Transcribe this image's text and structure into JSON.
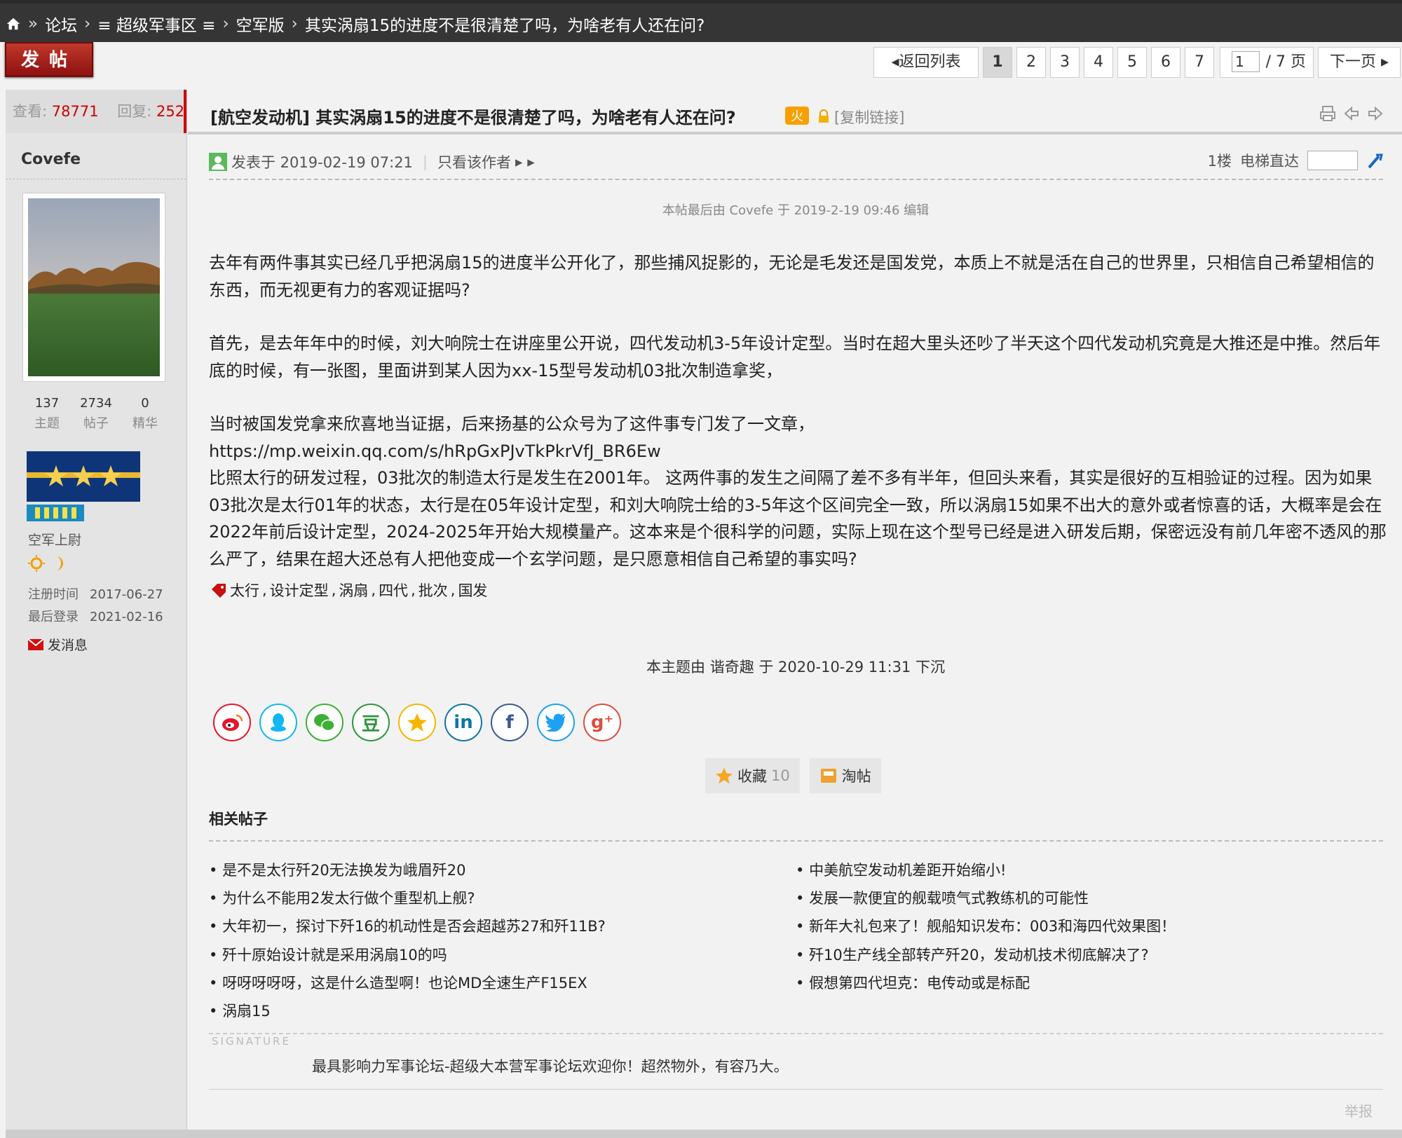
{
  "breadcrumb": {
    "sep1": "»",
    "forum": "论坛",
    "sep2": "›",
    "section": "≡ 超级军事区 ≡",
    "sep3": "›",
    "board": "空军版",
    "sep4": "›",
    "thread": "其实涡扇15的进度不是很清楚了吗，为啥老有人还在问?"
  },
  "toolbar": {
    "post_label": "发帖",
    "back_label": "返回列表",
    "pages": [
      "1",
      "2",
      "3",
      "4",
      "5",
      "6",
      "7"
    ],
    "current_page": "1",
    "page_input": "1",
    "page_total": "/ 7 页",
    "next_label": "下一页"
  },
  "thread": {
    "views_label": "查看:",
    "views": "78771",
    "replies_label": "回复:",
    "replies": "252",
    "title": "[航空发动机] 其实涡扇15的进度不是很清楚了吗，为啥老有人还在问?",
    "copy_link": "[复制链接]"
  },
  "author": {
    "name": "Covefe",
    "stats": [
      {
        "value": "137",
        "label": "主题"
      },
      {
        "value": "2734",
        "label": "帖子"
      },
      {
        "value": "0",
        "label": "精华"
      }
    ],
    "rank": "空军上尉",
    "reg_label": "注册时间",
    "reg_date": "2017-06-27",
    "login_label": "最后登录",
    "login_date": "2021-02-16",
    "send_msg": "发消息"
  },
  "post": {
    "posted_at": "发表于 2019-02-19 07:21",
    "only_author": "只看该作者",
    "floor": "1楼",
    "elevator": "电梯直达",
    "edit_note": "本帖最后由 Covefe 于 2019-2-19 09:46 编辑",
    "paragraphs": [
      "去年有两件事其实已经几乎把涡扇15的进度半公开化了，那些捕风捉影的，无论是毛发还是国发党，本质上不就是活在自己的世界里，只相信自己希望相信的东西，而无视更有力的客观证据吗?",
      "首先，是去年年中的时候，刘大响院士在讲座里公开说，四代发动机3-5年设计定型。当时在超大里头还吵了半天这个四代发动机究竟是大推还是中推。然后年底的时候，有一张图，里面讲到某人因为xx-15型号发动机03批次制造拿奖，",
      "当时被国发党拿来欣喜地当证据，后来扬基的公众号为了这件事专门发了一文章，\nhttps://mp.weixin.qq.com/s/hRpGxPJvTkPkrVfJ_BR6Ew\n比照太行的研发过程，03批次的制造太行是发生在2001年。 这两件事的发生之间隔了差不多有半年，但回头来看，其实是很好的互相验证的过程。因为如果03批次是太行01年的状态，太行是在05年设计定型，和刘大响院士给的3-5年这个区间完全一致，所以涡扇15如果不出大的意外或者惊喜的话，大概率是会在2022年前后设计定型，2024-2025年开始大规模量产。这本来是个很科学的问题，实际上现在这个型号已经是进入研发后期，保密远没有前几年密不透风的那么严了，结果在超大还总有人把他变成一个玄学问题，是只愿意相信自己希望的事实吗?"
    ],
    "tags": [
      "太行",
      "设计定型",
      "涡扇",
      "四代",
      "批次",
      "国发"
    ],
    "sink_note": "本主题由 谐奇趣 于 2020-10-29 11:31 下沉",
    "favorite_label": "收藏",
    "favorite_count": "10",
    "tao_label": "淘帖"
  },
  "share": [
    {
      "icon": "weibo-icon",
      "color": "#e6162d"
    },
    {
      "icon": "qq-icon",
      "color": "#12b7f5"
    },
    {
      "icon": "wechat-icon",
      "color": "#3cb034"
    },
    {
      "icon": "douban-icon",
      "color": "#2e963d",
      "glyph": "豆"
    },
    {
      "icon": "qzone-icon",
      "color": "#f7b500"
    },
    {
      "icon": "linkedin-icon",
      "color": "#0e76a8",
      "glyph": "in"
    },
    {
      "icon": "facebook-icon",
      "color": "#3b5998",
      "glyph": "f"
    },
    {
      "icon": "twitter-icon",
      "color": "#1da1f2"
    },
    {
      "icon": "googleplus-icon",
      "color": "#dc4e41",
      "glyph": "g⁺"
    }
  ],
  "related": {
    "title": "相关帖子",
    "left": [
      "是不是太行歼20无法换发为峨眉歼20",
      "为什么不能用2发太行做个重型机上舰?",
      "大年初一，探讨下歼16的机动性是否会超越苏27和歼11B?",
      "歼十原始设计就是采用涡扇10的吗",
      "呀呀呀呀呀，这是什么造型啊！也论MD全速生产F15EX",
      "涡扇15"
    ],
    "right": [
      "中美航空发动机差距开始缩小!",
      "发展一款便宜的舰载喷气式教练机的可能性",
      "新年大礼包来了！舰船知识发布：003和海四代效果图！",
      "歼10生产线全部转产歼20，发动机技术彻底解决了?",
      "假想第四代坦克：电传动或是标配"
    ]
  },
  "signature": {
    "label": "SIGNATURE",
    "text": "最具影响力军事论坛-超级大本营军事论坛欢迎你！超然物外，有容乃大。"
  },
  "report_label": "举报"
}
